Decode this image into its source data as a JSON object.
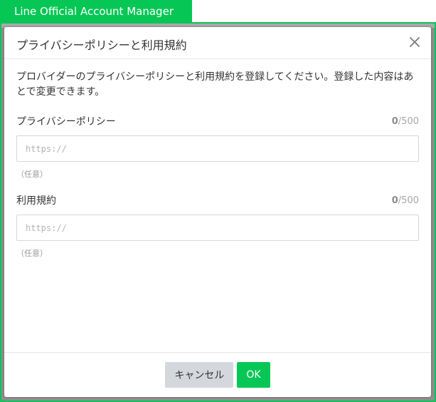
{
  "app": {
    "title": "Line Official Account Manager"
  },
  "colors": {
    "brand_green": "#06c755",
    "overlay_gray": "#8f8f8f",
    "cancel_gray": "#d4d7dc"
  },
  "modal": {
    "title": "プライバシーポリシーと利用規約",
    "close_icon": "close-icon",
    "description": "プロバイダーのプライバシーポリシーと利用規約を登録してください。登録した内容はあとで変更できます。",
    "fields": [
      {
        "label": "プライバシーポリシー",
        "count_current": "0",
        "count_max": "/500",
        "value": "",
        "placeholder": "https://",
        "note": "（任意）"
      },
      {
        "label": "利用規約",
        "count_current": "0",
        "count_max": "/500",
        "value": "",
        "placeholder": "https://",
        "note": "（任意）"
      }
    ],
    "buttons": {
      "cancel": "キャンセル",
      "ok": "OK"
    }
  }
}
